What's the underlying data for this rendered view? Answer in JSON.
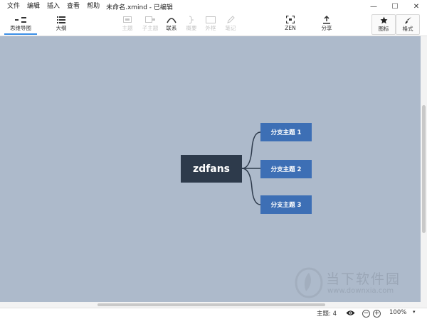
{
  "menubar": {
    "items": [
      "文件",
      "编辑",
      "插入",
      "查看",
      "帮助"
    ],
    "doc_title": "未命名.xmind - 已编辑",
    "window_controls": {
      "minimize": "—",
      "maximize": "☐",
      "close": "✕"
    }
  },
  "toolbar": {
    "mindmap": "思维导图",
    "outline": "大纲",
    "topic": "主题",
    "subtopic": "子主题",
    "relationship": "联系",
    "summary": "概要",
    "boundary": "外框",
    "note": "笔记",
    "zen": "ZEN",
    "share": "分享",
    "icons": "图标",
    "format": "格式"
  },
  "mindmap": {
    "central_topic": "zdfans",
    "branches": [
      "分支主题 1",
      "分支主题 2",
      "分支主题 3"
    ],
    "colors": {
      "canvas": "#adbacb",
      "central": "#2d3a4b",
      "branch": "#3d6fb5",
      "line": "#2d3a4b"
    }
  },
  "watermark": {
    "text": "当下软件园",
    "url": "www.downxia.com"
  },
  "statusbar": {
    "topic_count": "主题: 4",
    "zoom_out": "−",
    "zoom_in": "+",
    "zoom_level": "100%",
    "zoom_caret": "▾"
  },
  "icons": {
    "mindmap": "mindmap-icon",
    "outline": "outline-icon",
    "topic": "topic-icon",
    "subtopic": "subtopic-icon",
    "relationship": "relationship-icon",
    "summary": "summary-icon",
    "boundary": "boundary-icon",
    "note": "note-icon",
    "zen": "fullscreen-icon",
    "share": "share-icon",
    "icons": "star-icon",
    "format": "brush-icon",
    "eye": "eye-icon"
  }
}
